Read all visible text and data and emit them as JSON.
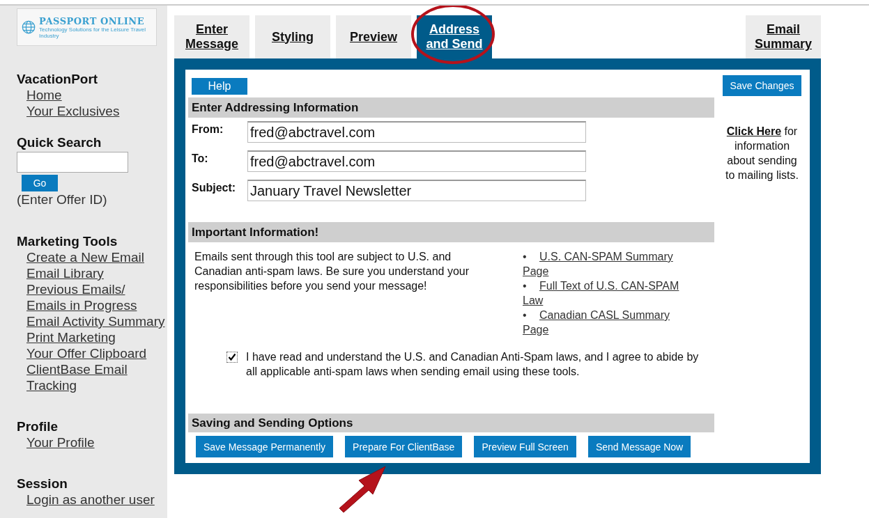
{
  "logo": {
    "name": "PASSPORT ONLINE",
    "tagline": "Technology Solutions for the Leisure Travel Industry"
  },
  "sidebar": {
    "sections": [
      {
        "kind": "links",
        "heading": "VacationPort",
        "links": [
          "Home",
          "Your Exclusives"
        ]
      },
      {
        "kind": "search",
        "heading": "Quick Search",
        "button": "Go",
        "hint": "(Enter Offer ID)"
      },
      {
        "kind": "links",
        "heading": "Marketing Tools",
        "links": [
          "Create a New Email",
          "Email Library",
          "Previous Emails/ Emails in Progress",
          "Email Activity Summary",
          "Print Marketing",
          "Your Offer Clipboard",
          "ClientBase Email Tracking"
        ]
      },
      {
        "kind": "links",
        "heading": "Profile",
        "links": [
          "Your Profile"
        ]
      },
      {
        "kind": "links",
        "heading": "Session",
        "links": [
          "Login as another user"
        ]
      }
    ]
  },
  "tabs": [
    {
      "label": "Enter Message",
      "selected": false
    },
    {
      "label": "Styling",
      "selected": false
    },
    {
      "label": "Preview",
      "selected": false
    },
    {
      "label": "Address and Send",
      "selected": true
    }
  ],
  "side_tab": {
    "label": "Email Summary",
    "selected": false
  },
  "help_button": "Help",
  "save_button": "Save Changes",
  "info": {
    "link": "Click Here",
    "text": "for information about sending to mailing lists."
  },
  "addressing": {
    "title": "Enter Addressing Information",
    "fields": [
      {
        "label": "From:",
        "value": "fred@abctravel.com"
      },
      {
        "label": "To:",
        "value": "fred@abctravel.com"
      },
      {
        "label": "Subject:",
        "value": "January Travel Newsletter"
      }
    ]
  },
  "important": {
    "title": "Important Information!",
    "text": "Emails sent through this tool are subject to U.S. and Canadian anti-spam laws. Be sure you understand your responsibilities before you send your message!",
    "links": [
      {
        "bullet": "•",
        "text": "U.S. CAN-SPAM Summary Page"
      },
      {
        "bullet": "•",
        "text": "Full Text of U.S. CAN-SPAM Law"
      },
      {
        "bullet": "•",
        "text": "Canadian CASL Summary Page"
      }
    ],
    "agreement": {
      "checked": true,
      "text": "I have read and understand the U.S. and Canadian Anti-Spam laws, and I agree to abide by all applicable anti-spam laws when sending email using these tools."
    }
  },
  "options": {
    "title": "Saving and Sending Options",
    "buttons": [
      "Save Message Permanently",
      "Prepare For ClientBase",
      "Preview Full Screen",
      "Send Message Now"
    ]
  }
}
